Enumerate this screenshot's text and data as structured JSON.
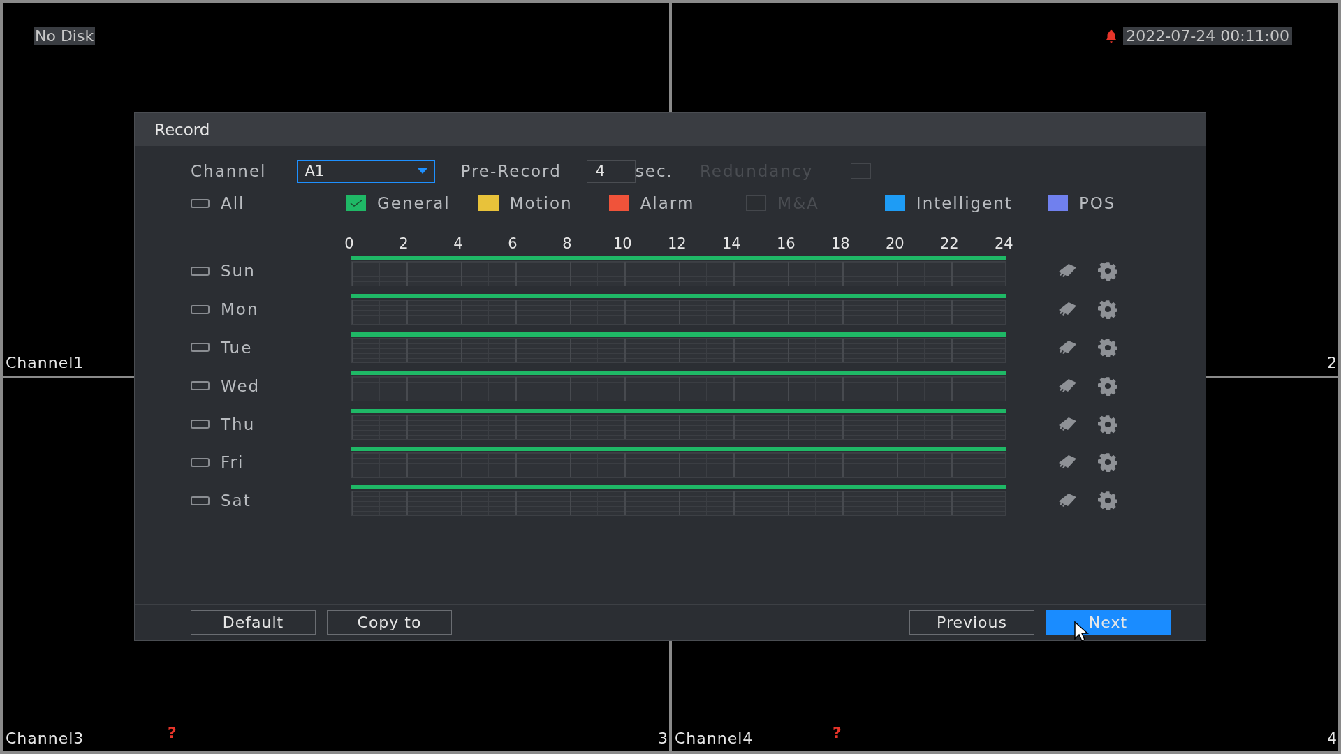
{
  "screen": {
    "disk_status": "No Disk",
    "datetime": "2022-07-24 00:11:00",
    "cells": [
      {
        "name": "Channel1"
      },
      {
        "number": "2"
      },
      {
        "name": "Channel3",
        "number": "3",
        "warning": "?"
      },
      {
        "name": "Channel4",
        "number": "4",
        "warning": "?"
      }
    ]
  },
  "dialog": {
    "title": "Record",
    "channel": {
      "label": "Channel",
      "value": "A1"
    },
    "pre_record": {
      "label": "Pre-Record",
      "value": "4",
      "unit": "sec."
    },
    "redundancy": {
      "label": "Redundancy",
      "checked": false,
      "disabled": true
    },
    "all": {
      "label": "All",
      "checked": false
    },
    "legend": [
      {
        "label": "General",
        "color": "#1fb866",
        "checked": true,
        "disabled": false
      },
      {
        "label": "Motion",
        "color": "#e8c23a",
        "checked": false,
        "disabled": false
      },
      {
        "label": "Alarm",
        "color": "#f0533a",
        "checked": false,
        "disabled": false
      },
      {
        "label": "M&A",
        "color": "#2a2d31",
        "checked": false,
        "disabled": true
      },
      {
        "label": "Intelligent",
        "color": "#1e9cf5",
        "checked": false,
        "disabled": false
      },
      {
        "label": "POS",
        "color": "#7080ee",
        "checked": false,
        "disabled": false
      }
    ],
    "hours": [
      "0",
      "2",
      "4",
      "6",
      "8",
      "10",
      "12",
      "14",
      "16",
      "18",
      "20",
      "22",
      "24"
    ],
    "days": [
      {
        "label": "Sun",
        "checked": false,
        "level": 1
      },
      {
        "label": "Mon",
        "checked": false,
        "level": 1
      },
      {
        "label": "Tue",
        "checked": false,
        "level": 1
      },
      {
        "label": "Wed",
        "checked": false,
        "level": 1
      },
      {
        "label": "Thu",
        "checked": false,
        "level": 1
      },
      {
        "label": "Fri",
        "checked": false,
        "level": 1
      },
      {
        "label": "Sat",
        "checked": false,
        "level": 1
      }
    ],
    "buttons": [
      {
        "label": "Default",
        "primary": false
      },
      {
        "label": "Copy to",
        "primary": false
      },
      {
        "label": "Previous",
        "primary": false
      },
      {
        "label": "Next",
        "primary": true
      }
    ]
  }
}
